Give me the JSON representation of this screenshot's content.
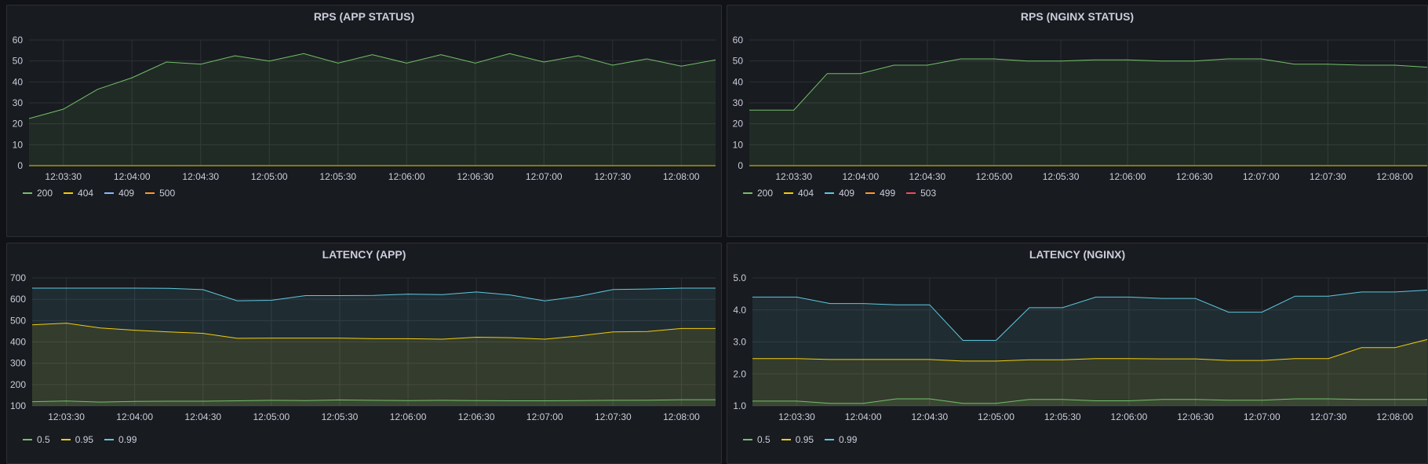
{
  "panels": [
    {
      "title": "RPS (APP STATUS)",
      "legend": [
        {
          "label": "200",
          "color": "#73bf69"
        },
        {
          "label": "404",
          "color": "#f2cc0c"
        },
        {
          "label": "409",
          "color": "#8ab8ff"
        },
        {
          "label": "500",
          "color": "#ff9830"
        }
      ]
    },
    {
      "title": "RPS (NGINX STATUS)",
      "legend": [
        {
          "label": "200",
          "color": "#73bf69"
        },
        {
          "label": "404",
          "color": "#f2cc0c"
        },
        {
          "label": "409",
          "color": "#5fc8e0"
        },
        {
          "label": "499",
          "color": "#ff9830"
        },
        {
          "label": "503",
          "color": "#f2495c"
        }
      ]
    },
    {
      "title": "LATENCY (APP)",
      "legend": [
        {
          "label": "0.5",
          "color": "#73bf69"
        },
        {
          "label": "0.95",
          "color": "#f2cc0c"
        },
        {
          "label": "0.99",
          "color": "#5fc8e0"
        }
      ]
    },
    {
      "title": "LATENCY (NGINX)",
      "legend": [
        {
          "label": "0.5",
          "color": "#73bf69"
        },
        {
          "label": "0.95",
          "color": "#f2cc0c"
        },
        {
          "label": "0.99",
          "color": "#5fc8e0"
        }
      ]
    }
  ],
  "chart_data": [
    {
      "type": "line",
      "title": "RPS (APP STATUS)",
      "x": [
        "12:03:15",
        "12:03:30",
        "12:03:45",
        "12:04:00",
        "12:04:15",
        "12:04:30",
        "12:04:45",
        "12:05:00",
        "12:05:15",
        "12:05:30",
        "12:05:45",
        "12:06:00",
        "12:06:15",
        "12:06:30",
        "12:06:45",
        "12:07:00",
        "12:07:15",
        "12:07:30",
        "12:07:45",
        "12:08:00",
        "12:08:15"
      ],
      "x_ticks": [
        "12:03:30",
        "12:04:00",
        "12:04:30",
        "12:05:00",
        "12:05:30",
        "12:06:00",
        "12:06:30",
        "12:07:00",
        "12:07:30",
        "12:08:00"
      ],
      "y_ticks": [
        "0",
        "10",
        "20",
        "30",
        "40",
        "50",
        "60"
      ],
      "ylim": [
        0,
        60
      ],
      "fill": true,
      "grid": true,
      "legend_placement": "bottom-left",
      "series": [
        {
          "name": "200",
          "color": "#73bf69",
          "values": [
            22.5,
            27,
            36.5,
            42,
            49.5,
            48.5,
            52.5,
            50,
            53.5,
            49,
            53,
            49,
            53,
            49,
            53.5,
            49.5,
            52.5,
            48,
            51,
            47.5,
            50.5
          ]
        },
        {
          "name": "404",
          "color": "#f2cc0c",
          "values": [
            0,
            0,
            0,
            0,
            0,
            0,
            0,
            0,
            0,
            0,
            0,
            0,
            0,
            0,
            0,
            0,
            0,
            0,
            0,
            0,
            0
          ]
        },
        {
          "name": "409",
          "color": "#8ab8ff",
          "values": [
            0,
            0,
            0,
            0,
            0,
            0,
            0,
            0,
            0,
            0,
            0,
            0,
            0,
            0,
            0,
            0,
            0,
            0,
            0,
            0,
            0
          ]
        },
        {
          "name": "500",
          "color": "#ff9830",
          "values": [
            0,
            0,
            0,
            0,
            0,
            0,
            0,
            0,
            0,
            0,
            0,
            0,
            0,
            0,
            0,
            0,
            0,
            0,
            0,
            0,
            0
          ]
        }
      ]
    },
    {
      "type": "line",
      "title": "RPS (NGINX STATUS)",
      "x": [
        "12:03:10",
        "12:03:30",
        "12:03:45",
        "12:04:00",
        "12:04:15",
        "12:04:30",
        "12:04:45",
        "12:05:00",
        "12:05:15",
        "12:05:30",
        "12:05:45",
        "12:06:00",
        "12:06:15",
        "12:06:30",
        "12:06:45",
        "12:07:00",
        "12:07:15",
        "12:07:30",
        "12:07:45",
        "12:08:00",
        "12:08:15"
      ],
      "x_ticks": [
        "12:03:30",
        "12:04:00",
        "12:04:30",
        "12:05:00",
        "12:05:30",
        "12:06:00",
        "12:06:30",
        "12:07:00",
        "12:07:30",
        "12:08:00"
      ],
      "y_ticks": [
        "0",
        "10",
        "20",
        "30",
        "40",
        "50",
        "60"
      ],
      "ylim": [
        0,
        60
      ],
      "fill": true,
      "grid": true,
      "legend_placement": "bottom-left",
      "series": [
        {
          "name": "200",
          "color": "#73bf69",
          "values": [
            26.5,
            26.5,
            44,
            44,
            48,
            48,
            51,
            51,
            50,
            50,
            50.5,
            50.5,
            50,
            50,
            51,
            51,
            48.5,
            48.5,
            48,
            48,
            47
          ]
        },
        {
          "name": "404",
          "color": "#f2cc0c",
          "values": [
            0,
            0,
            0,
            0,
            0,
            0,
            0,
            0,
            0,
            0,
            0,
            0,
            0,
            0,
            0,
            0,
            0,
            0,
            0,
            0,
            0
          ]
        },
        {
          "name": "409",
          "color": "#5fc8e0",
          "values": [
            0,
            0,
            0,
            0,
            0,
            0,
            0,
            0,
            0,
            0,
            0,
            0,
            0,
            0,
            0,
            0,
            0,
            0,
            0,
            0,
            0
          ]
        },
        {
          "name": "499",
          "color": "#ff9830",
          "values": [
            0,
            0,
            0,
            0,
            0,
            0,
            0,
            0,
            0,
            0,
            0,
            0,
            0,
            0,
            0,
            0,
            0,
            0,
            0,
            0,
            0
          ]
        },
        {
          "name": "503",
          "color": "#f2495c",
          "values": [
            0,
            0,
            0,
            0,
            0,
            0,
            0,
            0,
            0,
            0,
            0,
            0,
            0,
            0,
            0,
            0,
            0,
            0,
            0,
            0,
            0
          ]
        }
      ]
    },
    {
      "type": "area",
      "title": "LATENCY (APP)",
      "x": [
        "12:03:15",
        "12:03:30",
        "12:03:45",
        "12:04:00",
        "12:04:15",
        "12:04:30",
        "12:04:45",
        "12:05:00",
        "12:05:15",
        "12:05:30",
        "12:05:45",
        "12:06:00",
        "12:06:15",
        "12:06:30",
        "12:06:45",
        "12:07:00",
        "12:07:15",
        "12:07:30",
        "12:07:45",
        "12:08:00",
        "12:08:15"
      ],
      "x_ticks": [
        "12:03:30",
        "12:04:00",
        "12:04:30",
        "12:05:00",
        "12:05:30",
        "12:06:00",
        "12:06:30",
        "12:07:00",
        "12:07:30",
        "12:08:00"
      ],
      "y_ticks": [
        "100",
        "200",
        "300",
        "400",
        "500",
        "600",
        "700"
      ],
      "ylim": [
        100,
        700
      ],
      "fill": true,
      "grid": true,
      "legend_placement": "bottom-left",
      "series": [
        {
          "name": "0.5",
          "color": "#73bf69",
          "values": [
            120,
            123,
            118,
            121,
            122,
            122,
            124,
            126,
            125,
            128,
            126,
            125,
            126,
            125,
            124,
            124,
            125,
            126,
            127,
            129,
            129
          ]
        },
        {
          "name": "0.95",
          "color": "#f2cc0c",
          "values": [
            480,
            488,
            465,
            455,
            447,
            440,
            417,
            418,
            418,
            418,
            415,
            415,
            413,
            422,
            420,
            413,
            428,
            447,
            449,
            463,
            463
          ]
        },
        {
          "name": "0.99",
          "color": "#5fc8e0",
          "values": [
            652,
            652,
            652,
            652,
            651,
            645,
            593,
            595,
            617,
            617,
            618,
            624,
            622,
            634,
            620,
            592,
            614,
            646,
            648,
            652,
            652
          ]
        }
      ]
    },
    {
      "type": "area",
      "title": "LATENCY (NGINX)",
      "x": [
        "12:03:10",
        "12:03:30",
        "12:03:45",
        "12:04:00",
        "12:04:15",
        "12:04:30",
        "12:04:45",
        "12:05:00",
        "12:05:15",
        "12:05:30",
        "12:05:45",
        "12:06:00",
        "12:06:15",
        "12:06:30",
        "12:06:45",
        "12:07:00",
        "12:07:15",
        "12:07:30",
        "12:07:45",
        "12:08:00",
        "12:08:15"
      ],
      "x_ticks": [
        "12:03:30",
        "12:04:00",
        "12:04:30",
        "12:05:00",
        "12:05:30",
        "12:06:00",
        "12:06:30",
        "12:07:00",
        "12:07:30",
        "12:08:00"
      ],
      "y_ticks": [
        "1.0",
        "2.0",
        "3.0",
        "4.0",
        "5.0"
      ],
      "ylim": [
        1.0,
        5.0
      ],
      "fill": true,
      "grid": true,
      "legend_placement": "bottom-left",
      "series": [
        {
          "name": "0.5",
          "color": "#73bf69",
          "values": [
            1.15,
            1.15,
            1.08,
            1.08,
            1.22,
            1.22,
            1.08,
            1.08,
            1.2,
            1.2,
            1.16,
            1.16,
            1.2,
            1.2,
            1.18,
            1.18,
            1.22,
            1.22,
            1.2,
            1.2,
            1.2
          ]
        },
        {
          "name": "0.95",
          "color": "#f2cc0c",
          "values": [
            2.48,
            2.48,
            2.45,
            2.45,
            2.45,
            2.45,
            2.4,
            2.4,
            2.44,
            2.44,
            2.48,
            2.48,
            2.47,
            2.47,
            2.42,
            2.42,
            2.48,
            2.48,
            2.82,
            2.82,
            3.08
          ]
        },
        {
          "name": "0.99",
          "color": "#5fc8e0",
          "values": [
            4.4,
            4.4,
            4.2,
            4.2,
            4.16,
            4.16,
            3.05,
            3.05,
            4.07,
            4.07,
            4.4,
            4.4,
            4.36,
            4.36,
            3.93,
            3.93,
            4.43,
            4.43,
            4.56,
            4.56,
            4.62
          ]
        }
      ]
    }
  ]
}
